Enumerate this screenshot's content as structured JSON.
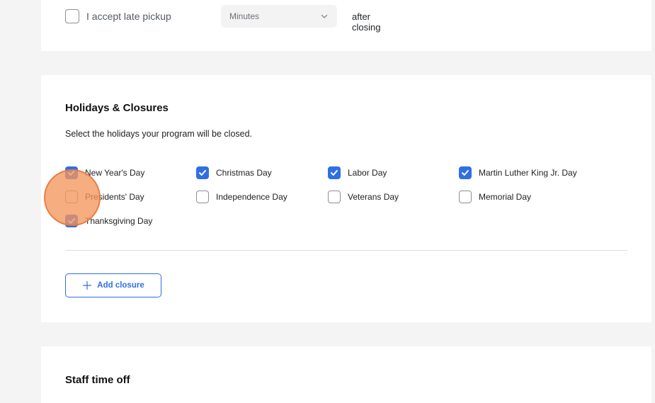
{
  "late_pickup": {
    "checkbox_label": "I accept late pickup",
    "checked": false,
    "select_value": "Minutes",
    "after_text": "after closing"
  },
  "holidays": {
    "title": "Holidays & Closures",
    "description": "Select the holidays your program will be closed.",
    "items": [
      {
        "label": "New Year's Day",
        "checked": true
      },
      {
        "label": "Christmas Day",
        "checked": true
      },
      {
        "label": "Labor Day",
        "checked": true
      },
      {
        "label": "Martin Luther King Jr. Day",
        "checked": true
      },
      {
        "label": "Presidents' Day",
        "checked": false
      },
      {
        "label": "Independence Day",
        "checked": false
      },
      {
        "label": "Veterans Day",
        "checked": false
      },
      {
        "label": "Memorial Day",
        "checked": false
      },
      {
        "label": "Thanksgiving Day",
        "checked": true
      }
    ],
    "add_button_label": "Add closure"
  },
  "staff": {
    "title": "Staff time off"
  },
  "colors": {
    "accent": "#2f6fe4",
    "touch_indicator": "#f4965c"
  }
}
